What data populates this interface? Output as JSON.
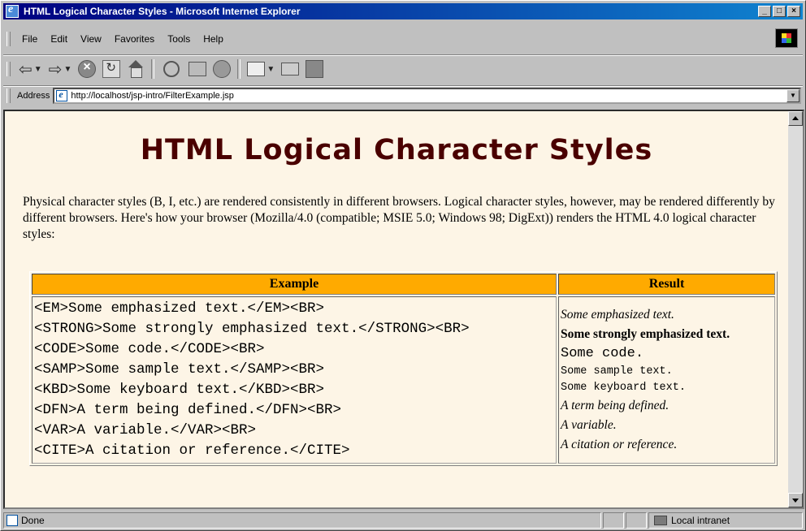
{
  "window": {
    "title": "HTML Logical Character Styles - Microsoft Internet Explorer"
  },
  "menu": [
    "File",
    "Edit",
    "View",
    "Favorites",
    "Tools",
    "Help"
  ],
  "toolbar": {
    "buttons": [
      "back-arrow-icon",
      "forward-arrow-icon",
      "stop-icon",
      "refresh-icon",
      "home-icon",
      "search-icon",
      "favorites-icon",
      "history-icon",
      "mail-icon",
      "print-icon",
      "edit-icon"
    ]
  },
  "address": {
    "label": "Address",
    "url": "http://localhost/jsp-intro/FilterExample.jsp"
  },
  "page": {
    "heading": "HTML Logical Character Styles",
    "intro": "Physical character styles (B, I, etc.) are rendered consistently in different browsers. Logical character styles, however, may be rendered differently by different browsers. Here's how your browser (Mozilla/4.0 (compatible; MSIE 5.0; Windows 98; DigExt)) renders the HTML 4.0 logical character styles:",
    "table": {
      "headers": [
        "Example",
        "Result"
      ],
      "examples": [
        "<EM>Some emphasized text.</EM><BR>",
        "<STRONG>Some strongly emphasized text.</STRONG><BR>",
        "<CODE>Some code.</CODE><BR>",
        "<SAMP>Some sample text.</SAMP><BR>",
        "<KBD>Some keyboard text.</KBD><BR>",
        "<DFN>A term being defined.</DFN><BR>",
        "<VAR>A variable.</VAR><BR>",
        "<CITE>A citation or reference.</CITE>"
      ],
      "results": {
        "em": "Some emphasized text.",
        "strong": "Some strongly emphasized text.",
        "code": "Some code.",
        "samp": "Some sample text.",
        "kbd": "Some keyboard text.",
        "dfn": "A term being defined.",
        "var": "A variable.",
        "cite": "A citation or reference."
      }
    }
  },
  "status": {
    "text": "Done",
    "zone": "Local intranet"
  },
  "colors": {
    "titlebar": "#000080",
    "page_bg": "#fdf5e6",
    "heading": "#4a0000",
    "table_header": "#ffaa00"
  }
}
